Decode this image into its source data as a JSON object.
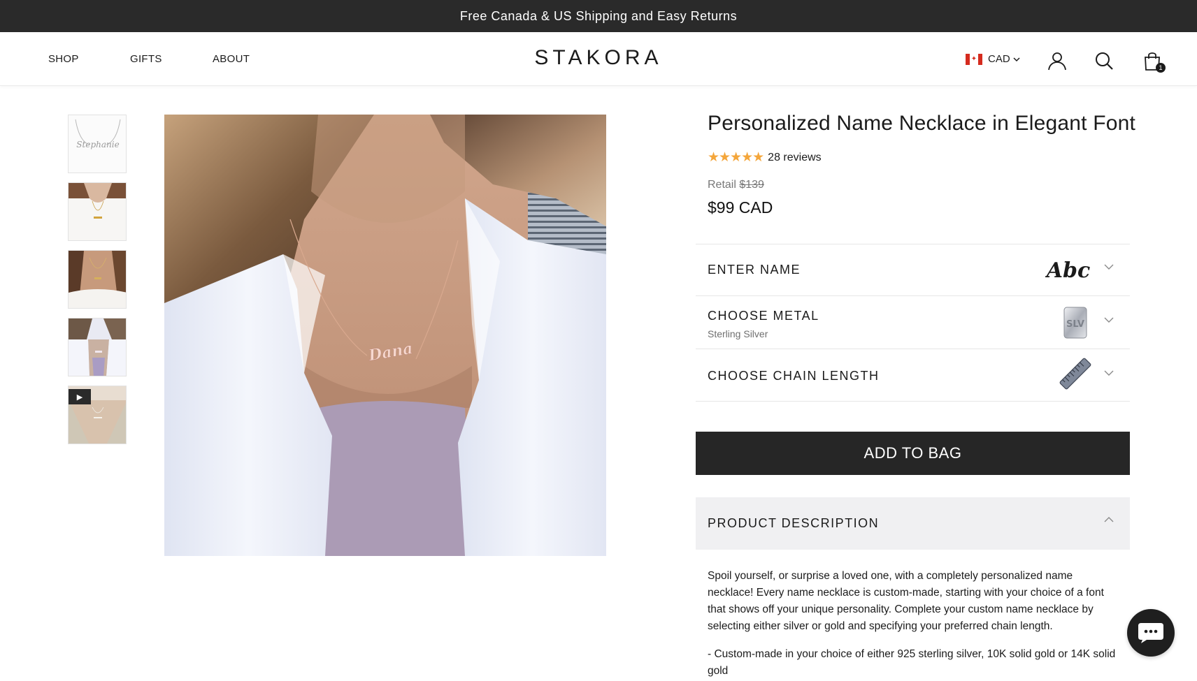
{
  "announcement": "Free Canada & US Shipping and Easy Returns",
  "nav": {
    "shop": "SHOP",
    "gifts": "GIFTS",
    "about": "ABOUT"
  },
  "brand": "STAKORA",
  "currency": {
    "code": "CAD",
    "flag": "canada-flag-icon"
  },
  "header_icons": [
    "account-icon",
    "search-icon",
    "bag-icon"
  ],
  "cart": {
    "count": "1"
  },
  "gallery": {
    "thumbnails": [
      {
        "name": "thumb-necklace-product",
        "thumb_text": "Stephanie"
      },
      {
        "name": "thumb-model-white-tee"
      },
      {
        "name": "thumb-model-closeup"
      },
      {
        "name": "thumb-model-white-coat"
      },
      {
        "name": "thumb-video",
        "has_play": true
      }
    ],
    "hero_pendant_text": "Dana"
  },
  "product": {
    "title": "Personalized Name Necklace in Elegant Font",
    "rating_stars": "★★★★★",
    "reviews": "28 reviews",
    "retail_label": "Retail",
    "retail_price": "$139",
    "price": "$99 CAD"
  },
  "options": {
    "name": {
      "label": "ENTER NAME",
      "swatch_text": "Abc"
    },
    "metal": {
      "label": "CHOOSE METAL",
      "selected": "Sterling Silver",
      "swatch_text": "SLV"
    },
    "chain": {
      "label": "CHOOSE CHAIN LENGTH"
    }
  },
  "add_to_bag": "ADD TO BAG",
  "description": {
    "heading": "PRODUCT DESCRIPTION",
    "paragraphs": [
      "Spoil yourself, or surprise a loved one, with a completely personalized name necklace!  Every name necklace is custom-made, starting with your choice of a font that shows off your unique personality. Complete your custom name necklace by selecting either silver or gold and specifying your preferred chain length.",
      "- Custom-made in your choice of either 925 sterling silver, 10K solid gold or 14K solid gold"
    ]
  },
  "colors": {
    "announcement_bg": "#2a2a2a",
    "button_bg": "#262626",
    "star": "#f4a63b",
    "accordion_bg": "#f0f0f2"
  }
}
